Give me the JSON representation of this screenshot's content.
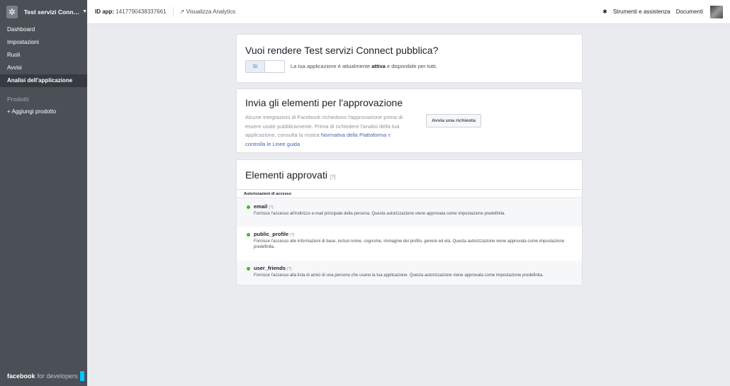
{
  "sidebar": {
    "app_name": "Test servizi Conn…",
    "items": [
      {
        "label": "Dashboard"
      },
      {
        "label": "Impostazioni"
      },
      {
        "label": "Ruoli"
      },
      {
        "label": "Avvisi"
      },
      {
        "label": "Analisi dell'applicazione"
      }
    ],
    "products_title": "Prodotti",
    "add_product": "+ Aggiungi prodotto",
    "footer_brand": "facebook",
    "footer_suffix": "for developers"
  },
  "topbar": {
    "app_id_label": "ID app:",
    "app_id_value": "1417790438337661",
    "analytics_label": "Visualizza Analytics",
    "tools_label": "Strumenti e assistenza",
    "docs_label": "Documenti"
  },
  "public_card": {
    "title": "Vuoi rendere Test servizi Connect pubblica?",
    "toggle_label": "Sì",
    "desc_before": "La tua applicazione è attualmente",
    "desc_status": "attiva",
    "desc_after": "e disponibile per tutti."
  },
  "review_card": {
    "title": "Invia gli elementi per l'approvazione",
    "body_1": "Alcune integrazioni di Facebook richiedono l'approvazione prima di essere usate pubblicamente. Prima di richiedere l'analisi della tua applicazione, consulta la nostra",
    "link_1": "Normativa della Piattaforma",
    "body_2": "e",
    "link_2": "controlla le Linee guida",
    "button_label": "Avvia una richiesta"
  },
  "approved_card": {
    "title": "Elementi approvati",
    "help": "[?]",
    "section_header": "Autorizzazioni di accesso",
    "permissions": [
      {
        "name": "email",
        "help": "[?]",
        "desc": "Fornisce l'accesso all'indirizzo e-mail principale della persona. Questa autorizzazione viene approvata come impostazione predefinita."
      },
      {
        "name": "public_profile",
        "help": "[?]",
        "desc": "Fornisce l'accesso alle informazioni di base, inclusi nome, cognome, immagine del profilo, genere ed età. Questa autorizzazione viene approvata come impostazione predefinita."
      },
      {
        "name": "user_friends",
        "help": "[?]",
        "desc": "Fornisce l'accesso alla lista di amici di una persona che usano la tua applicazione. Questa autorizzazione viene approvata come impostazione predefinita."
      }
    ]
  },
  "colors": {
    "sidebar_bg": "#4b4f56",
    "link": "#4267b2",
    "approved_dot": "#42b72a"
  }
}
